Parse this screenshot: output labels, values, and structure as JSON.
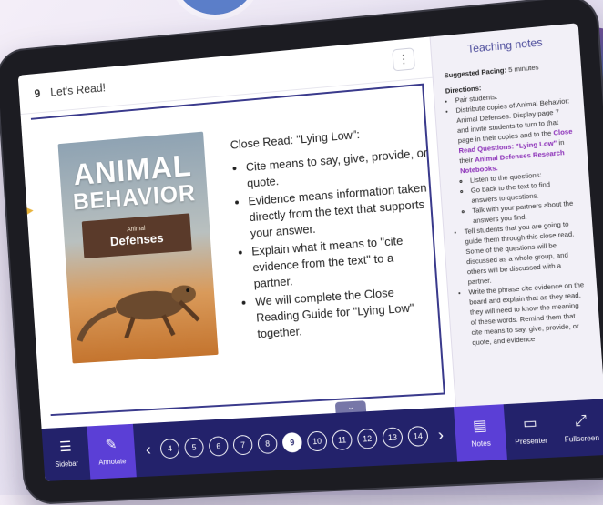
{
  "lesson": {
    "number": "9",
    "title": "Let's Read!",
    "menu_icon": "more-vertical-icon"
  },
  "book": {
    "title_line1": "ANIMAL",
    "title_line2": "BEHAVIOR",
    "series": "Animal",
    "subtitle": "Defenses"
  },
  "slide": {
    "heading": "Close Read: \"Lying Low\":",
    "bullets": [
      "Cite means to say, give, provide, or quote.",
      "Evidence means information taken directly from the text that supports your answer.",
      "Explain what it means to \"cite evidence from the text\" to a partner.",
      "We will complete the Close Reading Guide for \"Lying Low\" together."
    ]
  },
  "notes": {
    "title": "Teaching notes",
    "pacing_label": "Suggested Pacing:",
    "pacing_value": "5 minutes",
    "directions_label": "Directions:",
    "items": [
      "Pair students.",
      "Distribute copies of Animal Behavior: Animal Defenses. Display page 7 and invite students to turn to that page in their copies and to the",
      "Close Read Questions: \"Lying Low\"",
      "in their",
      "Animal Defenses Research Notebooks."
    ],
    "sub_items": [
      "Listen to the questions:",
      "Go back to the text to find answers to questions.",
      "Talk with your partners about the answers you find."
    ],
    "items2": [
      "Tell students that you are going to guide them through this close read. Some of the questions will be discussed as a whole group, and others will be discussed with a partner.",
      "Write the phrase cite evidence on the board and explain that as they read, they will need to know the meaning of these words. Remind them that cite means to say, give, provide, or quote, and evidence"
    ]
  },
  "toolbar": {
    "sidebar_label": "Sidebar",
    "annotate_label": "Annotate",
    "pages": [
      "4",
      "5",
      "6",
      "7",
      "8",
      "9",
      "10",
      "11",
      "12",
      "13",
      "14"
    ],
    "current_page": "9",
    "notes_label": "Notes",
    "presenter_label": "Presenter",
    "fullscreen_label": "Fullscreen"
  },
  "colors": {
    "toolbar": "#23226b",
    "active": "#5b3fd6",
    "accent": "#8b2fb8"
  }
}
